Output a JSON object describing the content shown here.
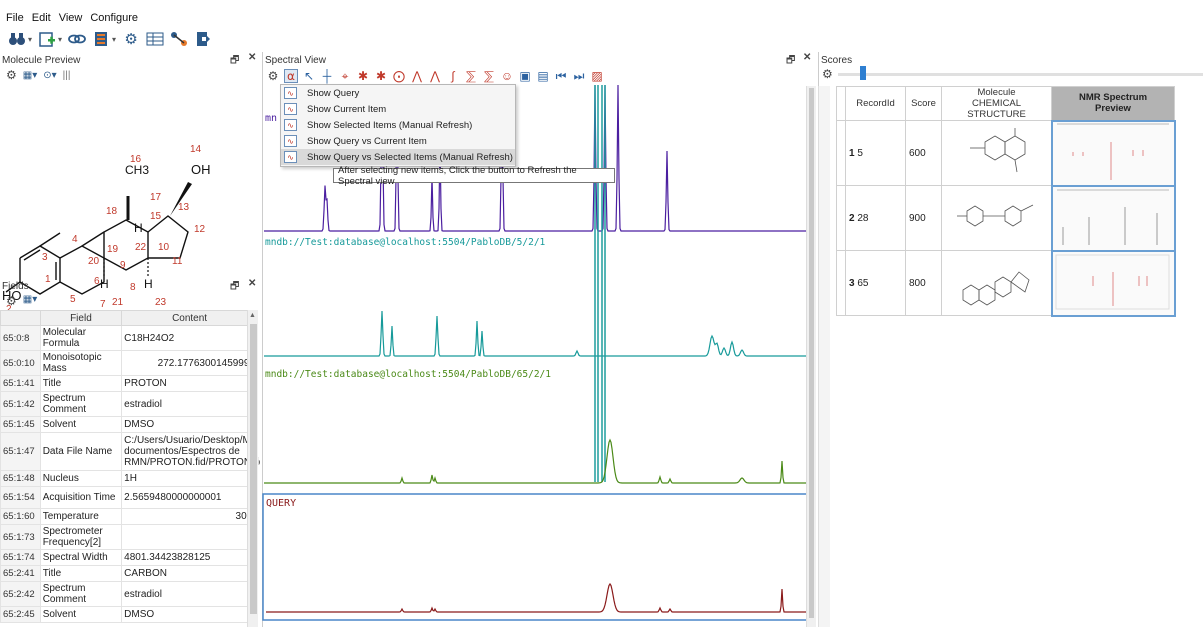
{
  "menu": {
    "file": "File",
    "edit": "Edit",
    "view": "View",
    "configure": "Configure"
  },
  "molecule_panel": {
    "title": "Molecule Preview",
    "atom_labels": {
      "oh_top": "OH",
      "oh_left": "HO",
      "ch3": "CH3",
      "h1": "H",
      "h2": "H",
      "h3": "H"
    },
    "numbers": [
      "16",
      "14",
      "17",
      "13",
      "18",
      "15",
      "12",
      "4",
      "3",
      "20",
      "19",
      "22",
      "10",
      "11",
      "9",
      "1",
      "6",
      "21",
      "23",
      "8",
      "5",
      "7",
      "2"
    ]
  },
  "fields_panel": {
    "title": "Fields",
    "col_field": "Field",
    "col_content": "Content",
    "rows": [
      {
        "key": "65:0:8",
        "field": "Molecular Formula",
        "content": "C18H24O2",
        "align": "left"
      },
      {
        "key": "65:0:10",
        "field": "Monoisotopic Mass",
        "content": "272.17763001459997",
        "align": "right"
      },
      {
        "key": "65:1:41",
        "field": "Title",
        "content": "PROTON",
        "align": "left"
      },
      {
        "key": "65:1:42",
        "field": "Spectrum Comment",
        "content": "estradiol",
        "align": "left"
      },
      {
        "key": "65:1:45",
        "field": "Solvent",
        "content": "DMSO",
        "align": "left"
      },
      {
        "key": "65:1:47",
        "field": "Data File Name",
        "content": "C:/Users/Usuario/Desktop/Mis documentos/Espectros de RMN/PROTON.fid/PROTON.fid/",
        "align": "left"
      },
      {
        "key": "65:1:48",
        "field": "Nucleus",
        "content": "1H",
        "align": "left"
      },
      {
        "key": "65:1:54",
        "field": "Acquisition Time",
        "content": "2.5659480000000001",
        "align": "left"
      },
      {
        "key": "65:1:60",
        "field": "Temperature",
        "content": "30.0",
        "align": "right"
      },
      {
        "key": "65:1:73",
        "field": "Spectrometer Frequency[2]",
        "content": "",
        "align": "left"
      },
      {
        "key": "65:1:74",
        "field": "Spectral Width",
        "content": "4801.34423828125",
        "align": "left"
      },
      {
        "key": "65:2:41",
        "field": "Title",
        "content": "CARBON",
        "align": "left"
      },
      {
        "key": "65:2:42",
        "field": "Spectrum Comment",
        "content": "estradiol",
        "align": "left"
      },
      {
        "key": "65:2:45",
        "field": "Solvent",
        "content": "DMSO",
        "align": "left"
      }
    ]
  },
  "spectral_panel": {
    "title": "Spectral View",
    "popup": [
      {
        "label": "Show Query",
        "icon": "query-icon"
      },
      {
        "label": "Show Current Item",
        "icon": "current-icon"
      },
      {
        "label": "Show Selected Items (Manual Refresh)",
        "icon": "selected-icon"
      },
      {
        "label": "Show Query vs Current Item",
        "icon": "query-vs-current-icon"
      },
      {
        "label": "Show Query vs Selected Items (Manual Refresh)",
        "icon": "query-vs-selected-icon"
      }
    ],
    "tooltip": "After selecting new items, Click the button to Refresh the Spectral view",
    "label1_partial": "mn",
    "label2": "mndb://Test:database@localhost:5504/PabloDB/5/2/1",
    "label3": "mndb://Test:database@localhost:5504/PabloDB/65/2/1",
    "query_label": "QUERY",
    "colors": {
      "s1": "#4b1fa0",
      "s2": "#179a9a",
      "s3": "#4b8a18",
      "query": "#8a1a1a",
      "teal_tall": "#1f9e9e"
    }
  },
  "scores_panel": {
    "title": "Scores",
    "headers": {
      "record_id": "RecordId",
      "score": "Score",
      "molecule_line1": "Molecule",
      "molecule_line2": "CHEMICAL STRUCTURE",
      "nmr_line1": "NMR Spectrum",
      "nmr_line2": "Preview"
    },
    "rows": [
      {
        "n": "1",
        "record_id": "5",
        "score": "600"
      },
      {
        "n": "2",
        "record_id": "28",
        "score": "900"
      },
      {
        "n": "3",
        "record_id": "65",
        "score": "800"
      }
    ]
  }
}
